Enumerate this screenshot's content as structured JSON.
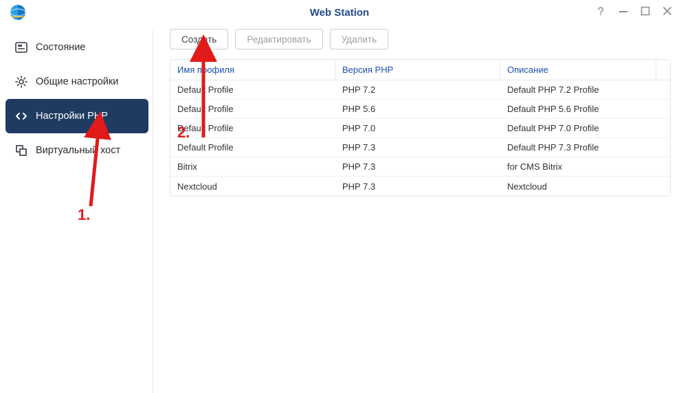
{
  "window": {
    "title": "Web Station"
  },
  "sidebar": {
    "items": [
      {
        "label": "Состояние"
      },
      {
        "label": "Общие настройки"
      },
      {
        "label": "Настройки PHP"
      },
      {
        "label": "Виртуальный хост"
      }
    ]
  },
  "toolbar": {
    "create": "Создать",
    "edit": "Редактировать",
    "delete": "Удалить"
  },
  "table": {
    "columns": {
      "profile": "Имя профиля",
      "version": "Версия PHP",
      "description": "Описание"
    },
    "rows": [
      {
        "profile": "Default Profile",
        "version": "PHP 7.2",
        "description": "Default PHP 7.2 Profile"
      },
      {
        "profile": "Default Profile",
        "version": "PHP 5.6",
        "description": "Default PHP 5.6 Profile"
      },
      {
        "profile": "Default Profile",
        "version": "PHP 7.0",
        "description": "Default PHP 7.0 Profile"
      },
      {
        "profile": "Default Profile",
        "version": "PHP 7.3",
        "description": "Default PHP 7.3 Profile"
      },
      {
        "profile": "Bitrix",
        "version": "PHP 7.3",
        "description": "for CMS Bitrix"
      },
      {
        "profile": "Nextcloud",
        "version": "PHP 7.3",
        "description": "Nextcloud"
      }
    ]
  },
  "annotation": {
    "label1": "1.",
    "label2": "2."
  }
}
